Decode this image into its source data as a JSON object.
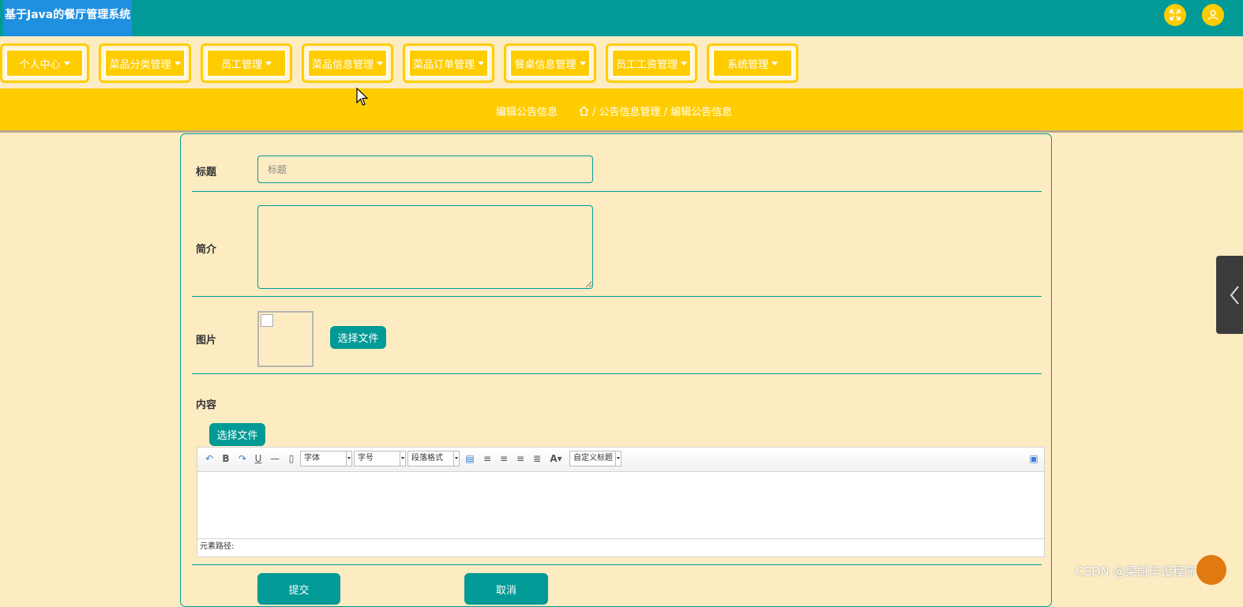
{
  "app": {
    "title": "基于Java的餐厅管理系统"
  },
  "header_icons": [
    "fullscreen-icon",
    "user-icon"
  ],
  "nav": {
    "items": [
      {
        "label": "个人中心"
      },
      {
        "label": "菜品分类管理"
      },
      {
        "label": "员工管理"
      },
      {
        "label": "菜品信息管理"
      },
      {
        "label": "菜品订单管理"
      },
      {
        "label": "餐桌信息管理"
      },
      {
        "label": "员工工资管理"
      },
      {
        "label": "系统管理"
      }
    ]
  },
  "breadcrumb": {
    "page_title": "编辑公告信息",
    "path": "/ 公告信息管理 / 编辑公告信息"
  },
  "form": {
    "title": {
      "label": "标题",
      "placeholder": "标题",
      "value": ""
    },
    "intro": {
      "label": "简介",
      "value": ""
    },
    "image": {
      "label": "图片",
      "button": "选择文件"
    },
    "content": {
      "label": "内容",
      "button": "选择文件"
    },
    "submit_label": "提交",
    "cancel_label": "取消"
  },
  "editor": {
    "font_select": "字体",
    "size_select": "字号",
    "paragraph_select": "段落格式",
    "heading_select": "自定义标题",
    "status_text": "元素路径:"
  },
  "watermark": "CSDN @梁凯毕设程序",
  "colors": {
    "primary": "#019a96",
    "accent": "#ffcc00",
    "background": "#fdecc2",
    "title_bg": "#1f8fe0"
  }
}
